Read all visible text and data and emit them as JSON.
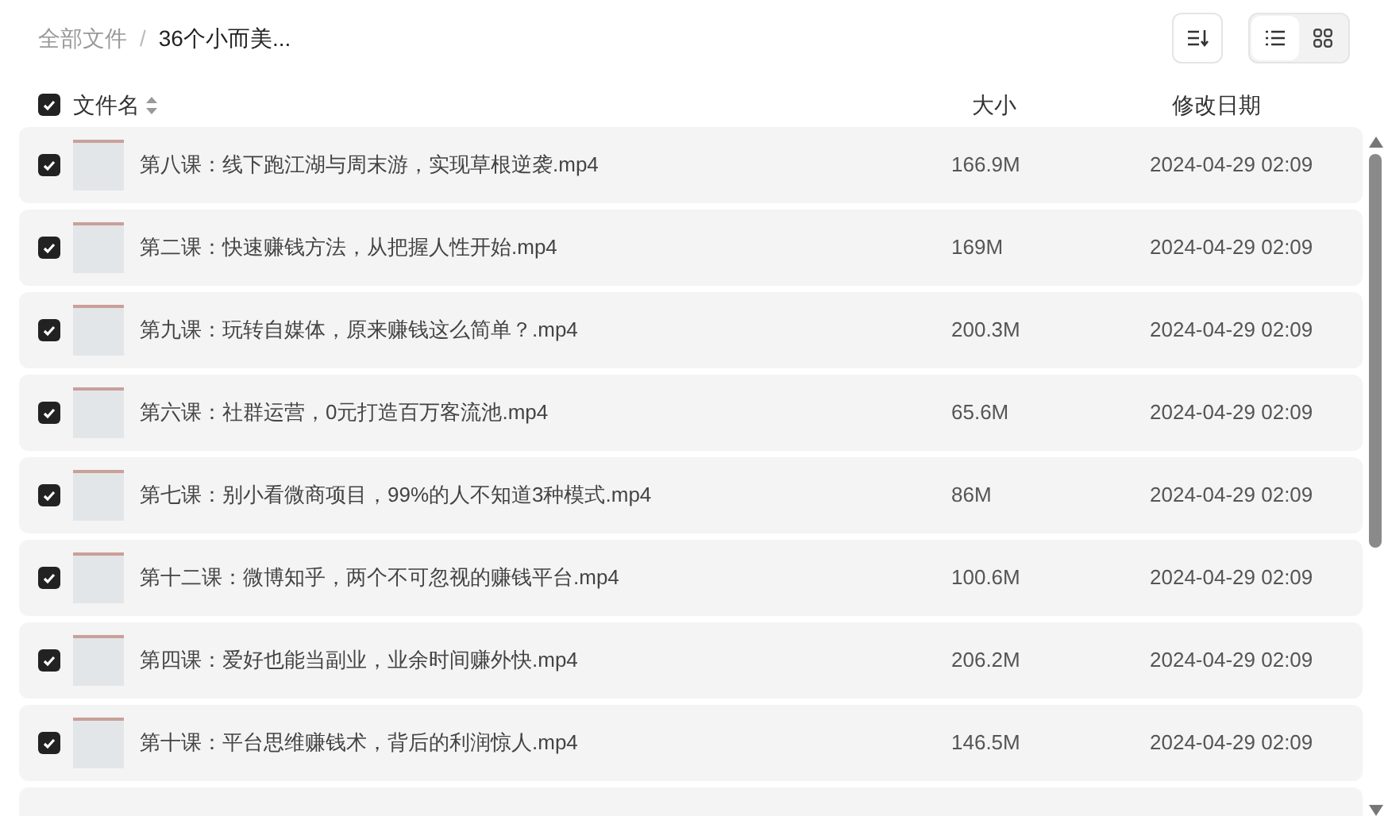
{
  "breadcrumb_separator": "/",
  "breadcrumb": [
    {
      "label": "全部文件",
      "current": false
    },
    {
      "label": "36个小而美...",
      "current": true
    }
  ],
  "view_toggle": [
    {
      "kind": "list",
      "selected": true
    },
    {
      "kind": "grid",
      "selected": false
    }
  ],
  "header": {
    "checked": true,
    "columns": [
      "文件名",
      "大小",
      "修改日期"
    ]
  },
  "rows": [
    {
      "checked": true,
      "name": "第八课：线下跑江湖与周末游，实现草根逆袭.mp4",
      "size": "166.9M",
      "date": "2024-04-29 02:09"
    },
    {
      "checked": true,
      "name": "第二课：快速赚钱方法，从把握人性开始.mp4",
      "size": "169M",
      "date": "2024-04-29 02:09"
    },
    {
      "checked": true,
      "name": "第九课：玩转自媒体，原来赚钱这么简单？.mp4",
      "size": "200.3M",
      "date": "2024-04-29 02:09"
    },
    {
      "checked": true,
      "name": "第六课：社群运营，0元打造百万客流池.mp4",
      "size": "65.6M",
      "date": "2024-04-29 02:09"
    },
    {
      "checked": true,
      "name": "第七课：别小看微商项目，99%的人不知道3种模式.mp4",
      "size": "86M",
      "date": "2024-04-29 02:09"
    },
    {
      "checked": true,
      "name": "第十二课：微博知乎，两个不可忽视的赚钱平台.mp4",
      "size": "100.6M",
      "date": "2024-04-29 02:09"
    },
    {
      "checked": true,
      "name": "第四课：爱好也能当副业，业余时间赚外快.mp4",
      "size": "206.2M",
      "date": "2024-04-29 02:09"
    },
    {
      "checked": true,
      "name": "第十课：平台思维赚钱术，背后的利润惊人.mp4",
      "size": "146.5M",
      "date": "2024-04-29 02:09"
    }
  ]
}
